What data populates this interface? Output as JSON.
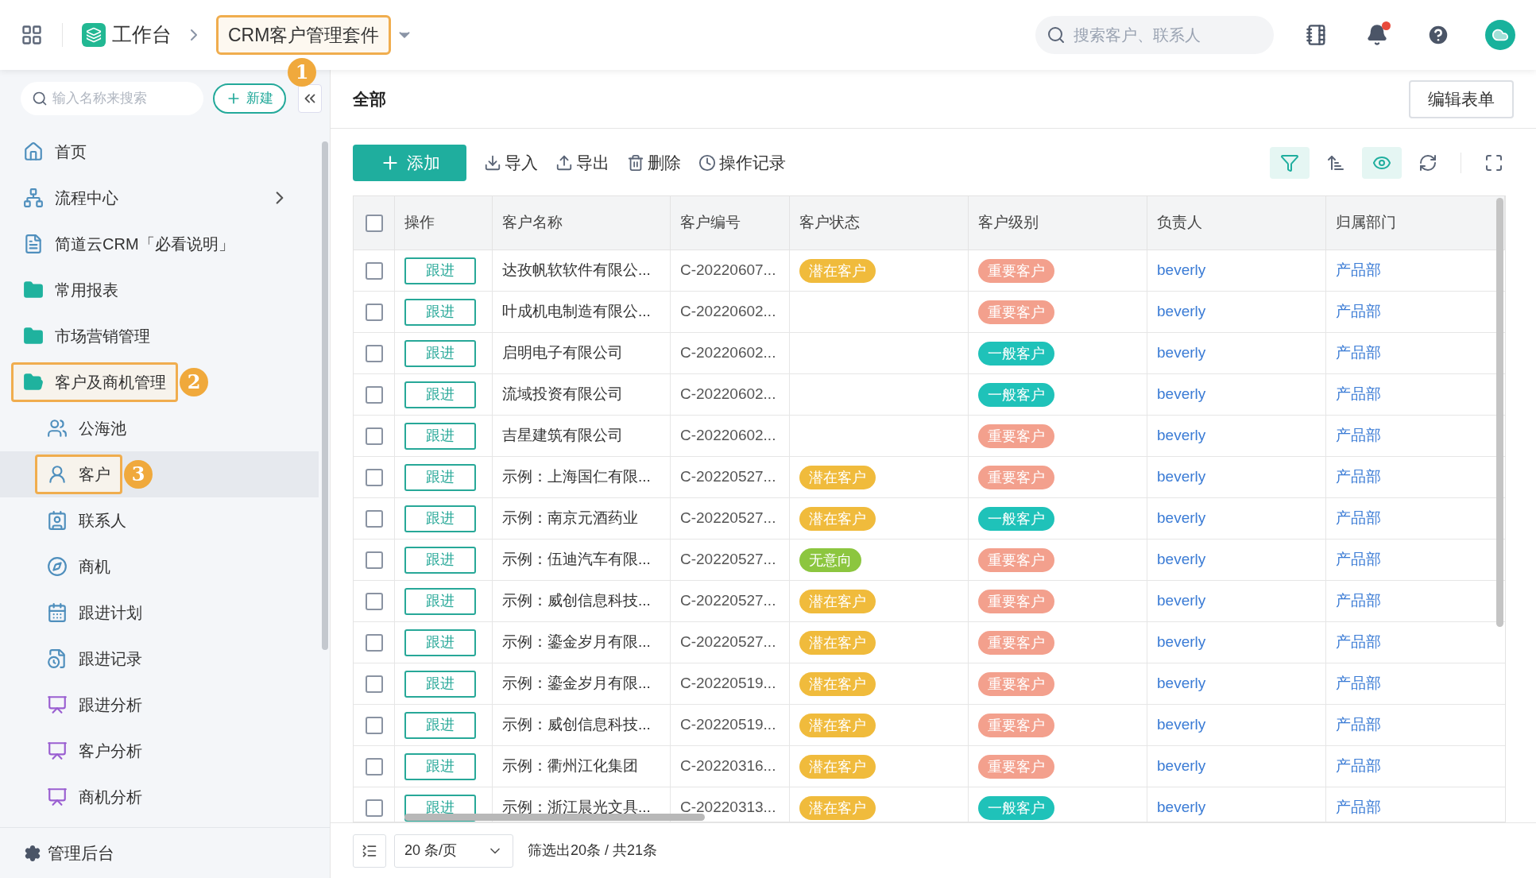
{
  "topbar": {
    "workspace": "工作台",
    "app": {
      "label": "CRM客户管理套件",
      "highlighted": true,
      "annotation": "1"
    },
    "search": {
      "placeholder": "搜索客户、联系人"
    },
    "notification": true
  },
  "sidebar": {
    "search": {
      "placeholder": "输入名称来搜索"
    },
    "new_button": "新建",
    "items": [
      {
        "label": "首页"
      },
      {
        "label": "流程中心",
        "expandable": true
      },
      {
        "label": "简道云CRM「必看说明」"
      },
      {
        "label": "常用报表"
      },
      {
        "label": "市场营销管理"
      },
      {
        "label": "客户及商机管理",
        "highlighted": true,
        "annotation": "2",
        "children": [
          {
            "label": "公海池",
            "selected": false
          },
          {
            "label": "客户",
            "selected": true,
            "highlighted": true,
            "annotation": "3"
          },
          {
            "label": "联系人",
            "selected": false
          },
          {
            "label": "商机",
            "selected": false
          },
          {
            "label": "跟进计划",
            "selected": false
          },
          {
            "label": "跟进记录",
            "selected": false
          },
          {
            "label": "跟进分析",
            "selected": false
          },
          {
            "label": "客户分析",
            "selected": false
          },
          {
            "label": "商机分析",
            "selected": false
          }
        ]
      }
    ],
    "footer": "管理后台"
  },
  "main": {
    "title": "全部",
    "edit_button": "编辑表单",
    "toolbar": {
      "add": "添加",
      "actions": [
        "导入",
        "导出",
        "删除",
        "操作记录"
      ],
      "view_tools": [
        {
          "active": true
        },
        {
          "active": false
        },
        {
          "active": true
        },
        {
          "active": false
        },
        {
          "active": false
        }
      ]
    },
    "table": {
      "all_checked": false,
      "columns": [
        "操作",
        "客户名称",
        "客户编号",
        "客户状态",
        "客户级别",
        "负责人",
        "归属部门"
      ],
      "rows": [
        {
          "checked": false,
          "action": "跟进",
          "name": "达孜帆软软件有限公...",
          "code": "C-20220607...",
          "status": {
            "label": "潜在客户",
            "color": "#f0bb3c"
          },
          "level": {
            "label": "重要客户",
            "color": "#f3a08d"
          },
          "owner": "beverly",
          "dept": "产品部"
        },
        {
          "checked": false,
          "action": "跟进",
          "name": "叶成机电制造有限公...",
          "code": "C-20220602...",
          "level": {
            "label": "重要客户",
            "color": "#f3a08d"
          },
          "owner": "beverly",
          "dept": "产品部"
        },
        {
          "checked": false,
          "action": "跟进",
          "name": "启明电子有限公司",
          "code": "C-20220602...",
          "level": {
            "label": "一般客户",
            "color": "#1fc2b9"
          },
          "owner": "beverly",
          "dept": "产品部"
        },
        {
          "checked": false,
          "action": "跟进",
          "name": "流域投资有限公司",
          "code": "C-20220602...",
          "level": {
            "label": "一般客户",
            "color": "#1fc2b9"
          },
          "owner": "beverly",
          "dept": "产品部"
        },
        {
          "checked": false,
          "action": "跟进",
          "name": "吉星建筑有限公司",
          "code": "C-20220602...",
          "level": {
            "label": "重要客户",
            "color": "#f3a08d"
          },
          "owner": "beverly",
          "dept": "产品部"
        },
        {
          "checked": false,
          "action": "跟进",
          "name": "示例：上海国仁有限...",
          "code": "C-20220527...",
          "status": {
            "label": "潜在客户",
            "color": "#f0bb3c"
          },
          "level": {
            "label": "重要客户",
            "color": "#f3a08d"
          },
          "owner": "beverly",
          "dept": "产品部"
        },
        {
          "checked": false,
          "action": "跟进",
          "name": "示例：南京元酒药业",
          "code": "C-20220527...",
          "status": {
            "label": "潜在客户",
            "color": "#f0bb3c"
          },
          "level": {
            "label": "一般客户",
            "color": "#1fc2b9"
          },
          "owner": "beverly",
          "dept": "产品部"
        },
        {
          "checked": false,
          "action": "跟进",
          "name": "示例：伍迪汽车有限...",
          "code": "C-20220527...",
          "status": {
            "label": "无意向",
            "color": "#8cc63f"
          },
          "level": {
            "label": "重要客户",
            "color": "#f3a08d"
          },
          "owner": "beverly",
          "dept": "产品部"
        },
        {
          "checked": false,
          "action": "跟进",
          "name": "示例：威创信息科技...",
          "code": "C-20220527...",
          "status": {
            "label": "潜在客户",
            "color": "#f0bb3c"
          },
          "level": {
            "label": "重要客户",
            "color": "#f3a08d"
          },
          "owner": "beverly",
          "dept": "产品部"
        },
        {
          "checked": false,
          "action": "跟进",
          "name": "示例：鎏金岁月有限...",
          "code": "C-20220527...",
          "status": {
            "label": "潜在客户",
            "color": "#f0bb3c"
          },
          "level": {
            "label": "重要客户",
            "color": "#f3a08d"
          },
          "owner": "beverly",
          "dept": "产品部"
        },
        {
          "checked": false,
          "action": "跟进",
          "name": "示例：鎏金岁月有限...",
          "code": "C-20220519...",
          "status": {
            "label": "潜在客户",
            "color": "#f0bb3c"
          },
          "level": {
            "label": "重要客户",
            "color": "#f3a08d"
          },
          "owner": "beverly",
          "dept": "产品部"
        },
        {
          "checked": false,
          "action": "跟进",
          "name": "示例：威创信息科技...",
          "code": "C-20220519...",
          "status": {
            "label": "潜在客户",
            "color": "#f0bb3c"
          },
          "level": {
            "label": "重要客户",
            "color": "#f3a08d"
          },
          "owner": "beverly",
          "dept": "产品部"
        },
        {
          "checked": false,
          "action": "跟进",
          "name": "示例：衢州江化集团",
          "code": "C-20220316...",
          "status": {
            "label": "潜在客户",
            "color": "#f0bb3c"
          },
          "level": {
            "label": "重要客户",
            "color": "#f3a08d"
          },
          "owner": "beverly",
          "dept": "产品部"
        },
        {
          "checked": false,
          "action": "跟进",
          "name": "示例：浙江晨光文具...",
          "code": "C-20220313...",
          "status": {
            "label": "潜在客户",
            "color": "#f0bb3c"
          },
          "level": {
            "label": "一般客户",
            "color": "#1fc2b9"
          },
          "owner": "beverly",
          "dept": "产品部"
        }
      ]
    },
    "footer": {
      "page_size": "20 条/页",
      "summary": "筛选出20条 / 共21条"
    }
  }
}
